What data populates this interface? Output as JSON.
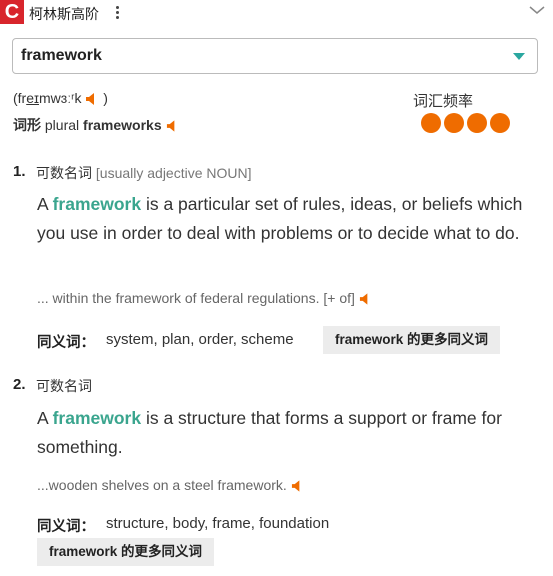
{
  "app": {
    "logo_letter": "C",
    "title": "柯林斯高阶"
  },
  "search": {
    "value": "framework"
  },
  "pronunciation": {
    "open": "(fr",
    "stressed": "eɪ",
    "rest": "mwɜːʳk",
    "close": ")"
  },
  "frequency": {
    "label": "词汇频率",
    "level": 4
  },
  "inflection": {
    "label": "词形",
    "kind": "plural",
    "form": "frameworks"
  },
  "senses": [
    {
      "num": "1.",
      "pos": "可数名词",
      "grammar": "[usually adjective NOUN]",
      "def_pre": "A ",
      "headword": "framework",
      "def_post": " is a particular set of rules, ideas, or beliefs which you use in order to deal with problems or to decide what to do.",
      "example": "... within the framework of federal regulations.",
      "example_tag": "[+ of]",
      "syn_label": "同义词：",
      "synonyms": "system, plan, order, scheme",
      "more_label": "framework 的更多同义词"
    },
    {
      "num": "2.",
      "pos": "可数名词",
      "grammar": "",
      "def_pre": "A ",
      "headword": "framework",
      "def_post": " is a structure that forms a support or frame for something.",
      "example": "...wooden shelves on a steel framework.",
      "example_tag": "",
      "syn_label": "同义词：",
      "synonyms": "structure, body, frame, foundation",
      "more_label": "framework 的更多同义词"
    }
  ],
  "colors": {
    "brand": "#d8252c",
    "accent": "#ef6c00",
    "headword": "#3aa58e"
  }
}
